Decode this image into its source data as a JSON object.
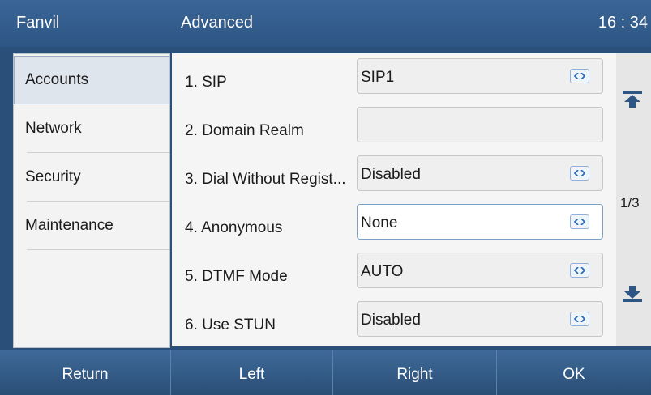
{
  "status_bar": {
    "brand": "Fanvil",
    "title": "Advanced",
    "time": "16 : 34"
  },
  "sidebar": {
    "items": [
      {
        "label": "Accounts",
        "active": true
      },
      {
        "label": "Network",
        "active": false
      },
      {
        "label": "Security",
        "active": false
      },
      {
        "label": "Maintenance",
        "active": false
      }
    ]
  },
  "settings": {
    "rows": [
      {
        "label": "1. SIP",
        "value": "SIP1",
        "has_toggle": true
      },
      {
        "label": "2. Domain Realm",
        "value": "",
        "has_toggle": false
      },
      {
        "label": "3. Dial Without Regist...",
        "value": "Disabled",
        "has_toggle": true
      },
      {
        "label": "4. Anonymous",
        "value": "None",
        "has_toggle": true,
        "focused": true
      },
      {
        "label": "5. DTMF Mode",
        "value": "AUTO",
        "has_toggle": true
      },
      {
        "label": "6. Use STUN",
        "value": "Disabled",
        "has_toggle": true
      }
    ]
  },
  "scroller": {
    "page": "1/3",
    "up_icon": "page-up-icon",
    "down_icon": "page-down-icon"
  },
  "softkeys": {
    "return_label": "Return",
    "left_label": "Left",
    "right_label": "Right",
    "ok_label": "OK"
  },
  "colors": {
    "header": "#2d5684",
    "softkey": "#2a4e76",
    "focus_border": "#7aa0c7"
  }
}
